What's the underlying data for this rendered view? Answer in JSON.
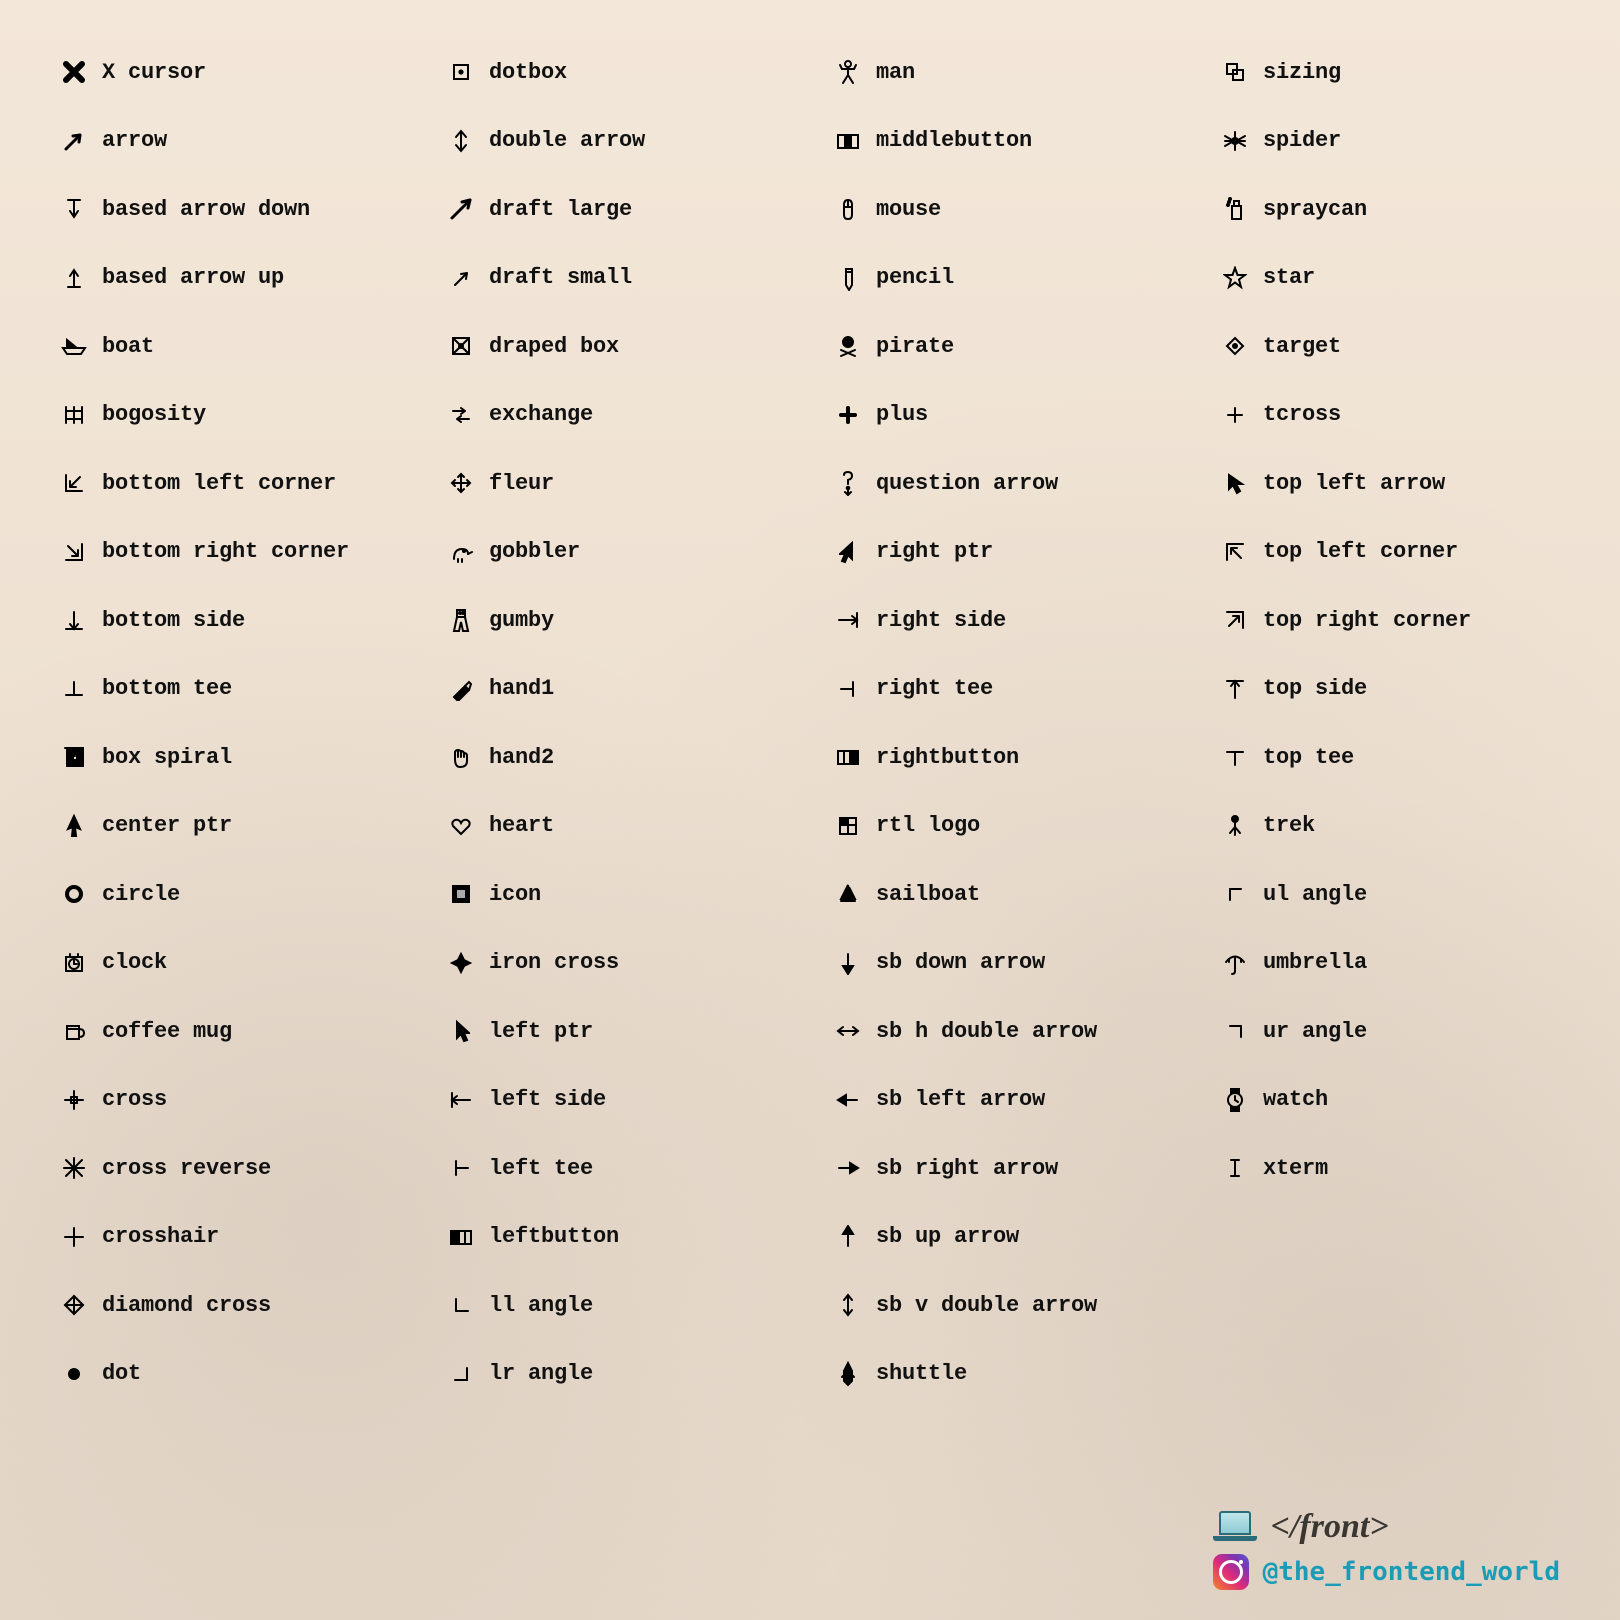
{
  "columns": [
    [
      "X cursor",
      "arrow",
      "based arrow down",
      "based arrow up",
      "boat",
      "bogosity",
      "bottom left corner",
      "bottom right corner",
      "bottom side",
      "bottom tee",
      "box spiral",
      "center ptr",
      "circle",
      "clock",
      "coffee mug",
      "cross",
      "cross reverse",
      "crosshair",
      "diamond cross",
      "dot"
    ],
    [
      "dotbox",
      "double arrow",
      "draft large",
      "draft small",
      "draped box",
      "exchange",
      "fleur",
      "gobbler",
      "gumby",
      "hand1",
      "hand2",
      "heart",
      "icon",
      "iron cross",
      "left ptr",
      "left side",
      "left tee",
      "leftbutton",
      "ll angle",
      "lr angle"
    ],
    [
      "man",
      "middlebutton",
      "mouse",
      "pencil",
      "pirate",
      "plus",
      "question arrow",
      "right ptr",
      "right side",
      "right tee",
      "rightbutton",
      "rtl logo",
      "sailboat",
      "sb down arrow",
      "sb h double arrow",
      "sb left arrow",
      "sb right arrow",
      "sb up arrow",
      "sb v double arrow",
      "shuttle"
    ],
    [
      "sizing",
      "spider",
      "spraycan",
      "star",
      "target",
      "tcross",
      "top left arrow",
      "top left corner",
      "top right corner",
      "top side",
      "top tee",
      "trek",
      "ul angle",
      "umbrella",
      "ur angle",
      "watch",
      "xterm"
    ]
  ],
  "iconKeys": [
    [
      "x-cursor",
      "arrow",
      "based-arrow-down",
      "based-arrow-up",
      "boat",
      "bogosity",
      "bottom-left-corner",
      "bottom-right-corner",
      "bottom-side",
      "bottom-tee",
      "box-spiral",
      "center-ptr",
      "circle",
      "clock",
      "coffee-mug",
      "cross",
      "cross-reverse",
      "crosshair",
      "diamond-cross",
      "dot"
    ],
    [
      "dotbox",
      "double-arrow",
      "draft-large",
      "draft-small",
      "draped-box",
      "exchange",
      "fleur",
      "gobbler",
      "gumby",
      "hand1",
      "hand2",
      "heart",
      "icon",
      "iron-cross",
      "left-ptr",
      "left-side",
      "left-tee",
      "leftbutton",
      "ll-angle",
      "lr-angle"
    ],
    [
      "man",
      "middlebutton",
      "mouse",
      "pencil",
      "pirate",
      "plus",
      "question-arrow",
      "right-ptr",
      "right-side",
      "right-tee",
      "rightbutton",
      "rtl-logo",
      "sailboat",
      "sb-down-arrow",
      "sb-h-double-arrow",
      "sb-left-arrow",
      "sb-right-arrow",
      "sb-up-arrow",
      "sb-v-double-arrow",
      "shuttle"
    ],
    [
      "sizing",
      "spider",
      "spraycan",
      "star",
      "target",
      "tcross",
      "top-left-arrow",
      "top-left-corner",
      "top-right-corner",
      "top-side",
      "top-tee",
      "trek",
      "ul-angle",
      "umbrella",
      "ur-angle",
      "watch",
      "xterm"
    ]
  ],
  "footer": {
    "brand": "</front>",
    "handle": "@the_frontend_world"
  }
}
